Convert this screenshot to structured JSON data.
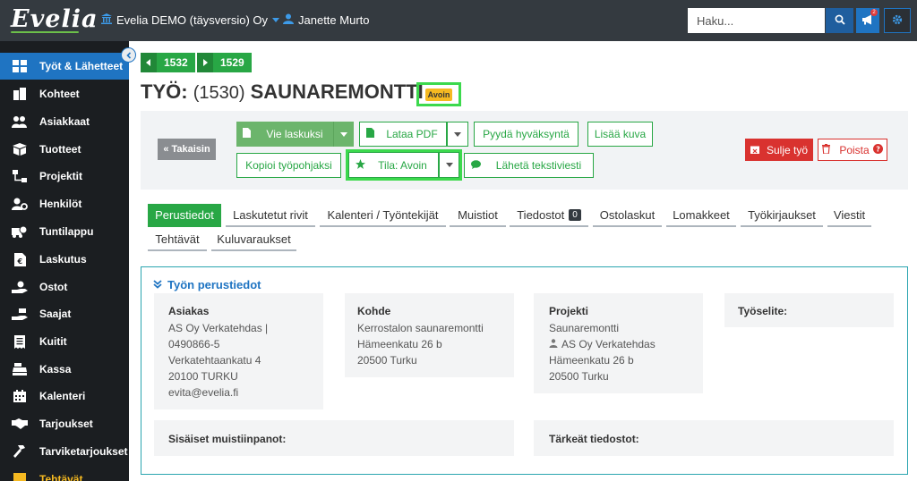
{
  "topbar": {
    "logo": "Evelia",
    "organization": "Evelia DEMO (täysversio) Oy",
    "user": "Janette Murto",
    "search_placeholder": "Haku...",
    "notification_count": "2"
  },
  "sidebar": {
    "items": [
      {
        "label": "Työt & Lähetteet",
        "icon": "grid-icon"
      },
      {
        "label": "Kohteet",
        "icon": "buildings-icon"
      },
      {
        "label": "Asiakkaat",
        "icon": "users-icon"
      },
      {
        "label": "Tuotteet",
        "icon": "box-icon"
      },
      {
        "label": "Projektit",
        "icon": "sitemap-icon"
      },
      {
        "label": "Henkilöt",
        "icon": "user-cog-icon"
      },
      {
        "label": "Tuntilappu",
        "icon": "truck-clock-icon"
      },
      {
        "label": "Laskutus",
        "icon": "invoice-icon"
      },
      {
        "label": "Ostot",
        "icon": "hand-coin-icon"
      },
      {
        "label": "Saajat",
        "icon": "hand-money-icon"
      },
      {
        "label": "Kuitit",
        "icon": "receipt-icon"
      },
      {
        "label": "Kassa",
        "icon": "cash-register-icon"
      },
      {
        "label": "Kalenteri",
        "icon": "calendar-icon"
      },
      {
        "label": "Tarjoukset",
        "icon": "handshake-icon"
      },
      {
        "label": "Tarviketarjoukset",
        "icon": "hammer-icon"
      },
      {
        "label": "Tehtävät",
        "icon": "tasks-icon"
      }
    ]
  },
  "nav": {
    "prev": "1532",
    "next": "1529"
  },
  "page": {
    "title_prefix": "TYÖ:",
    "title_number": "(1530)",
    "title_name": "SAUNAREMONTTI",
    "status": "Avoin"
  },
  "actions": {
    "back": "Takaisin",
    "export_invoice": "Vie laskuksi",
    "download_pdf": "Lataa PDF",
    "request_approval": "Pyydä hyväksyntä",
    "add_image": "Lisää kuva",
    "copy_template": "Kopioi työpohjaksi",
    "status": "Tila: Avoin",
    "send_sms": "Lähetä tekstiviesti",
    "close_job": "Sulje työ",
    "delete": "Poista"
  },
  "tabs": [
    {
      "label": "Perustiedot"
    },
    {
      "label": "Laskutetut rivit"
    },
    {
      "label": "Kalenteri / Työntekijät"
    },
    {
      "label": "Muistiot"
    },
    {
      "label": "Tiedostot",
      "badge": "0"
    },
    {
      "label": "Ostolaskut"
    },
    {
      "label": "Lomakkeet"
    },
    {
      "label": "Työkirjaukset"
    },
    {
      "label": "Viestit"
    },
    {
      "label": "Tehtävät"
    },
    {
      "label": "Kuluvaraukset"
    }
  ],
  "info": {
    "section_title": "Työn perustiedot",
    "customer": {
      "title": "Asiakas",
      "lines": [
        "AS Oy Verkatehdas |",
        "0490866-5",
        "Verkatehtaankatu 4",
        "20100 TURKU",
        "evita@evelia.fi"
      ]
    },
    "site": {
      "title": "Kohde",
      "lines": [
        "Kerrostalon saunaremontti",
        "Hämeenkatu 26 b",
        "20500 Turku"
      ]
    },
    "project": {
      "title": "Projekti",
      "lines": [
        "Saunaremontti",
        "AS Oy Verkatehdas",
        "Hämeenkatu 26 b",
        "20500 Turku"
      ]
    },
    "description": {
      "title": "Työselite:"
    },
    "internal_notes": {
      "title": "Sisäiset muistiinpanot:"
    },
    "important_files": {
      "title": "Tärkeät tiedostot:"
    }
  },
  "colors": {
    "topbar": "#343a40",
    "sidebar": "#1b1e21",
    "active": "#1f74c2",
    "green": "#28a745",
    "red": "#d9322f",
    "highlight": "#3cd94d",
    "badge": "#f5b921"
  }
}
